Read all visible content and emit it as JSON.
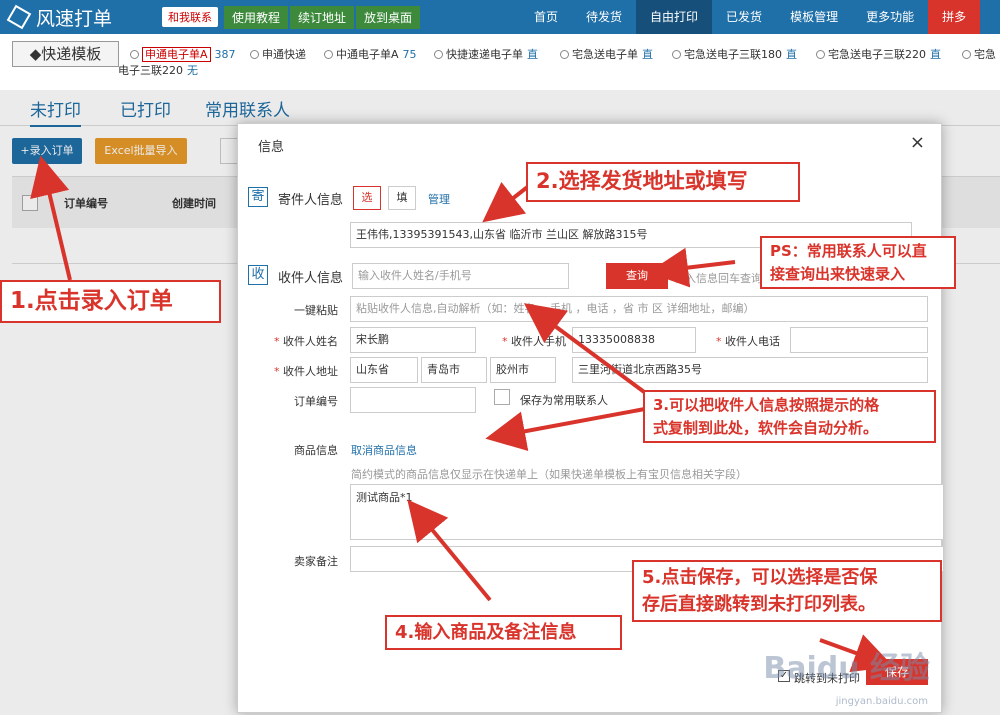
{
  "app": {
    "name": "风速打单",
    "contact": "和我联系",
    "tools": [
      "使用教程",
      "续订地址",
      "放到桌面"
    ]
  },
  "nav": [
    "首页",
    "待发货",
    "自由打印",
    "已发货",
    "模板管理",
    "更多功能",
    "拼多"
  ],
  "templates": {
    "title": "快递模板",
    "items": [
      {
        "name": "申通电子单A",
        "count": "387"
      },
      {
        "name": "申通快递",
        "count": ""
      },
      {
        "name": "中通电子单A",
        "count": "75"
      },
      {
        "name": "快捷速递电子单",
        "count": "直"
      },
      {
        "name": "宅急送电子单",
        "count": "直"
      },
      {
        "name": "宅急送电子三联180",
        "count": "直"
      },
      {
        "name": "宅急送电子三联220",
        "count": "直"
      },
      {
        "name": "宅急",
        "count": ""
      }
    ],
    "wrapped": {
      "name": "电子三联220",
      "count": "无"
    }
  },
  "tabs": [
    "未打印",
    "已打印",
    "常用联系人"
  ],
  "toolbar": {
    "add_order": "+录入订单",
    "excel_import": "Excel批量导入"
  },
  "table": {
    "headers": [
      "订单编号",
      "创建时间"
    ]
  },
  "modal": {
    "title": "信息",
    "close": "×",
    "sender": {
      "icon": "寄",
      "label": "寄件人信息",
      "btn_select": "选",
      "btn_fill": "填",
      "manage": "管理",
      "address": "王伟伟,13395391543,山东省 临沂市 兰山区 解放路315号"
    },
    "receiver": {
      "icon": "收",
      "label": "收件人信息",
      "search_placeholder": "输入收件人姓名/手机号",
      "query_btn": "查询",
      "query_hint": "输入信息回车查询",
      "paste_label": "一键粘贴",
      "paste_placeholder": "粘贴收件人信息,自动解析（如：姓名 ，手机 ，电话 ，省 市 区 详细地址，邮编）",
      "name_label": "收件人姓名",
      "name": "宋长鹏",
      "mobile_label": "收件人手机",
      "mobile": "13335008838",
      "phone_label": "收件人电话",
      "phone": "",
      "address_label": "收件人地址",
      "province": "山东省",
      "city": "青岛市",
      "district": "胶州市",
      "detail": "三里河街道北京西路35号",
      "order_label": "订单编号",
      "order_no": "",
      "save_contact": "保存为常用联系人"
    },
    "goods": {
      "label": "商品信息",
      "cancel_link": "取消商品信息",
      "hint": "简约模式的商品信息仅显示在快递单上（如果快递单模板上有宝贝信息相关字段）",
      "content": "测试商品*1"
    },
    "remark": {
      "label": "卖家备注",
      "value": ""
    },
    "footer": {
      "jump_label": "跳转到未打印",
      "save": "保存"
    }
  },
  "callouts": {
    "c1": "1.点击录入订单",
    "c2": "2.选择发货地址或填写",
    "ps_line1": "PS：常用联系人可以直",
    "ps_line2": "接查询出来快速录入",
    "c3_line1": "3.可以把收件人信息按照提示的格",
    "c3_line2": "式复制到此处，软件会自动分析。",
    "c4": "4.输入商品及备注信息",
    "c5_line1": "5.点击保存，可以选择是否保",
    "c5_line2": "存后直接跳转到未打印列表。"
  },
  "watermark": {
    "main": "Baidu 经验",
    "sub": "jingyan.baidu.com"
  },
  "colors": {
    "brand": "#1f6fa8",
    "accent": "#d9342b",
    "excel": "#e89a2a"
  }
}
